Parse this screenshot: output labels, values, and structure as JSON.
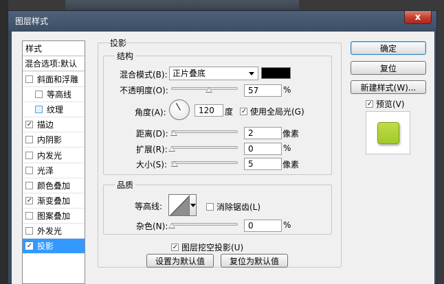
{
  "window": {
    "title": "图层样式",
    "close_symbol": "x"
  },
  "styles_panel": {
    "header": "样式",
    "blending": "混合选项:默认",
    "items": [
      {
        "label": "斜面和浮雕",
        "checked": false,
        "sub": false,
        "selected": false
      },
      {
        "label": "等高线",
        "checked": false,
        "sub": true,
        "selected": false
      },
      {
        "label": "纹理",
        "checked": false,
        "sub": true,
        "selected": false
      },
      {
        "label": "描边",
        "checked": true,
        "sub": false,
        "selected": false
      },
      {
        "label": "内阴影",
        "checked": false,
        "sub": false,
        "selected": false
      },
      {
        "label": "内发光",
        "checked": false,
        "sub": false,
        "selected": false
      },
      {
        "label": "光泽",
        "checked": false,
        "sub": false,
        "selected": false
      },
      {
        "label": "颜色叠加",
        "checked": false,
        "sub": false,
        "selected": false
      },
      {
        "label": "渐变叠加",
        "checked": true,
        "sub": false,
        "selected": false
      },
      {
        "label": "图案叠加",
        "checked": false,
        "sub": false,
        "selected": false
      },
      {
        "label": "外发光",
        "checked": false,
        "sub": false,
        "selected": false
      },
      {
        "label": "投影",
        "checked": true,
        "sub": false,
        "selected": true
      }
    ]
  },
  "drop_shadow": {
    "section_title": "投影",
    "structure": {
      "title": "结构",
      "blend_mode_label": "混合模式(B):",
      "blend_mode_value": "正片叠底",
      "shadow_color": "#000000",
      "opacity_label": "不透明度(O):",
      "opacity_value": "57",
      "opacity_unit": "%",
      "opacity_fraction": 0.57,
      "angle_label": "角度(A):",
      "angle_value": "120",
      "angle_unit": "度",
      "global_light_label": "使用全局光(G)",
      "global_light_checked": true,
      "distance_label": "距离(D):",
      "distance_value": "2",
      "distance_unit": "像素",
      "spread_label": "扩展(R):",
      "spread_value": "0",
      "spread_unit": "%",
      "size_label": "大小(S):",
      "size_value": "5",
      "size_unit": "像素"
    },
    "quality": {
      "title": "品质",
      "contour_label": "等高线:",
      "anti_alias_label": "消除锯齿(L)",
      "anti_alias_checked": false,
      "noise_label": "杂色(N):",
      "noise_value": "0",
      "noise_unit": "%"
    },
    "knockout_label": "图层挖空投影(U)",
    "knockout_checked": true,
    "make_default_label": "设置为默认值",
    "reset_default_label": "复位为默认值"
  },
  "actions": {
    "ok_label": "确定",
    "reset_label": "复位",
    "new_style_label": "新建样式(W)...",
    "preview_label": "预览(V)",
    "preview_checked": true,
    "preview_color": "#a3c92a"
  }
}
